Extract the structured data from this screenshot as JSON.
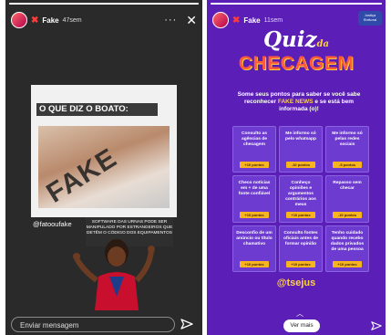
{
  "left_story": {
    "progress": 1.0,
    "username": "Fake",
    "time": "47sem",
    "card": {
      "title": "O QUE DIZ O BOATO:",
      "stamp": "FAKE",
      "caption": "SOFTWARE DAS URNAS PODE SER MANIPULADO POR ESTRANGEIROS QUE DETÊM O CÓDIGO DOS EQUIPAMENTOS"
    },
    "handle": "@fatooufake",
    "message_placeholder": "Enviar mensagem"
  },
  "right_story": {
    "username": "Fake",
    "time": "11sem",
    "logo_text": "Justiça Eleitoral",
    "title_main": "Quiz",
    "title_da": "da",
    "title_checagem": "CHECAGEM",
    "subtitle_pre": "Some seus pontos para saber se você sabe reconhecer ",
    "subtitle_fake": "FAKE NEWS",
    "subtitle_post": " e se está bem informada (o)!",
    "tiles": [
      {
        "text": "Consulto as agências de checagem",
        "points": "+10 pontos"
      },
      {
        "text": "Me informo só pelo whatsapp",
        "points": "-10 pontos"
      },
      {
        "text": "Me informo só pelas redes sociais",
        "points": "-5 pontos"
      },
      {
        "text": "Checo notícias em + de uma fonte confiável",
        "points": "+10 pontos"
      },
      {
        "text": "Conheço opiniões e argumentos contrários aos meus",
        "points": "+10 pontos"
      },
      {
        "text": "Repasso sem checar",
        "points": "-10 pontos"
      },
      {
        "text": "Desconfio de um anúncio ou título chamativo",
        "points": "+10 pontos"
      },
      {
        "text": "Consulto fontes oficiais antes de formar opinião",
        "points": "+10 pontos"
      },
      {
        "text": "Tenho cuidado quando recebo dados privados de uma pessoa",
        "points": "+10 pontos"
      }
    ],
    "handle": "@tsejus",
    "see_more": "Ver mais"
  }
}
